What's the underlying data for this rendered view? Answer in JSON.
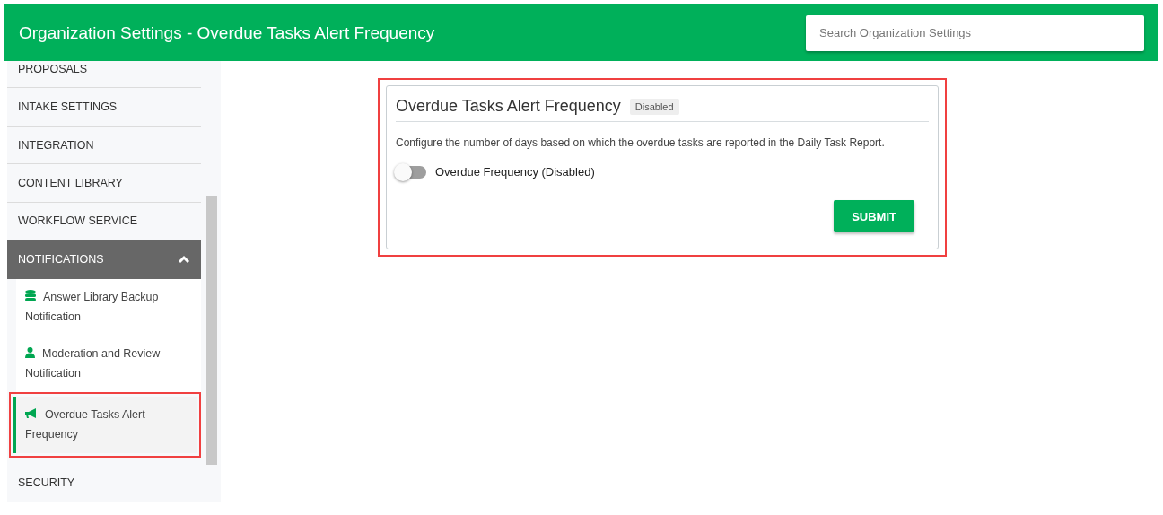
{
  "header": {
    "title": "Organization Settings - Overdue Tasks Alert Frequency",
    "search": {
      "placeholder": "Search Organization Settings"
    }
  },
  "sidebar": {
    "items": [
      {
        "label": "PROPOSALS",
        "expanded": false
      },
      {
        "label": "INTAKE SETTINGS",
        "expanded": false
      },
      {
        "label": "INTEGRATION",
        "expanded": false
      },
      {
        "label": "CONTENT LIBRARY",
        "expanded": false
      },
      {
        "label": "WORKFLOW SERVICE",
        "expanded": false
      },
      {
        "label": "NOTIFICATIONS",
        "expanded": true,
        "children": [
          {
            "label": "Answer Library Backup Notification",
            "selected": false,
            "highlighted": false
          },
          {
            "label": "Moderation and Review Notification",
            "selected": false,
            "highlighted": false
          },
          {
            "label": "Overdue Tasks Alert Frequency",
            "selected": true,
            "highlighted": true
          }
        ]
      },
      {
        "label": "SECURITY",
        "expanded": false
      }
    ]
  },
  "card": {
    "title": "Overdue Tasks Alert Frequency",
    "badge": "Disabled",
    "highlighted": true,
    "description": "Configure the number of days based on which the overdue tasks are reported in the Daily Task Report.",
    "toggle": {
      "label": "Overdue Frequency (Disabled)",
      "on": false
    },
    "button": "SUBMIT"
  }
}
